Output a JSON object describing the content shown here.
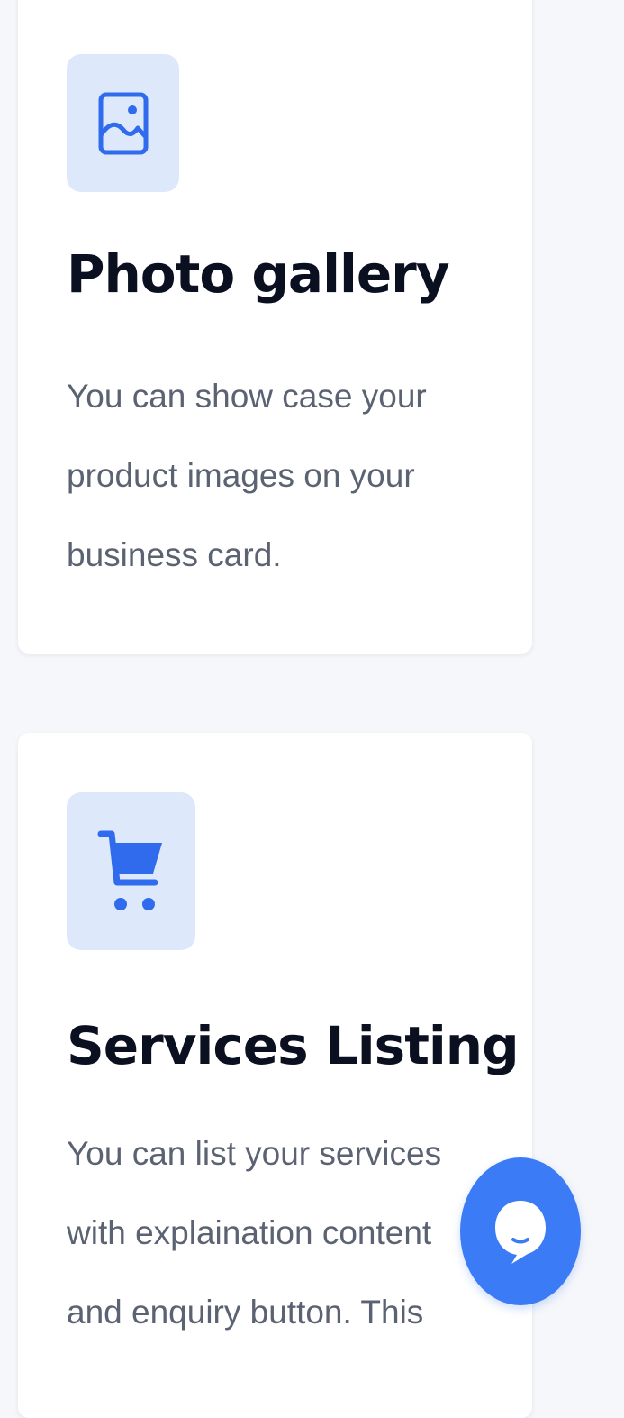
{
  "colors": {
    "accent": "#2f6bec",
    "icon_tile_bg": "#dde9fb",
    "chat_button": "#3b7bf5"
  },
  "features": [
    {
      "icon": "image-icon",
      "title": "Photo gallery",
      "description": [
        "You can show case your",
        "product images on your",
        "business card."
      ]
    },
    {
      "icon": "shopping-cart-icon",
      "title": "Services Listing",
      "description": [
        "You can list your services",
        "with explaination content",
        "and enquiry button. This"
      ]
    }
  ],
  "chat_button": {
    "icon": "chat-bubble-icon"
  }
}
